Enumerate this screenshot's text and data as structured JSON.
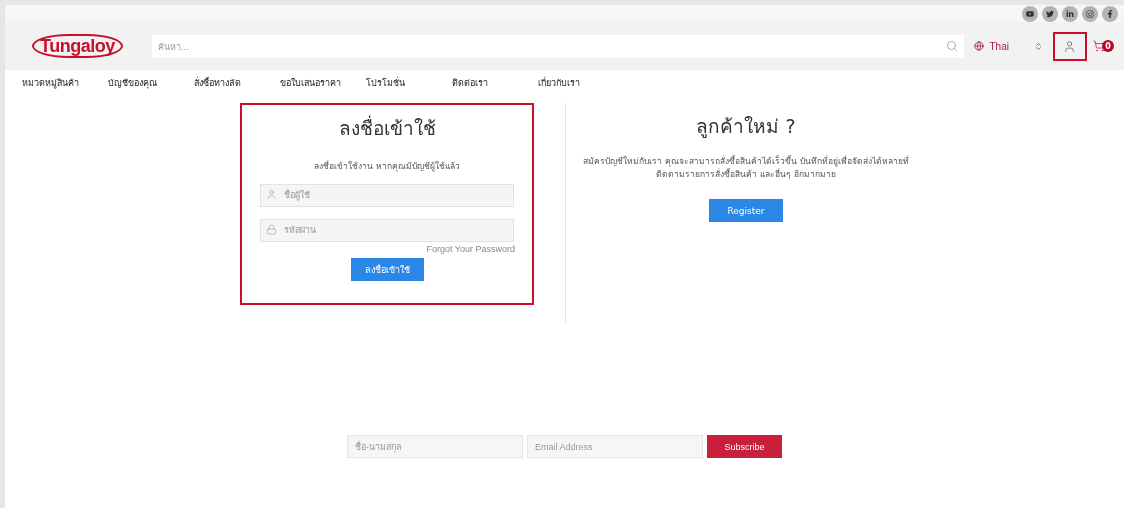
{
  "social_links": [
    {
      "kind": "youtube"
    },
    {
      "kind": "twitter"
    },
    {
      "kind": "linkedin"
    },
    {
      "kind": "instagram"
    },
    {
      "kind": "facebook"
    }
  ],
  "header": {
    "logo": "Tungaloy",
    "search": {
      "placeholder": "ค้นหา..."
    },
    "language": "Thai",
    "account_highlighted": true,
    "cart_count": "0"
  },
  "nav": [
    "หมวดหมู่สินค้า",
    "บัญชีของคุณ",
    "สั่งซื้อทางลัด",
    "ขอใบเสนอราคา",
    "โปรโมชั่น",
    "ติดต่อเรา",
    "เกี่ยวกับเรา"
  ],
  "login": {
    "highlighted": true,
    "title": "ลงชื่อเข้าใช้",
    "subtitle": "ลงชื่อเข้าใช้งาน หากคุณมีบัญชีผู้ใช้แล้ว",
    "username": {
      "placeholder": "ชื่อผู้ใช้"
    },
    "password": {
      "placeholder": "รหัสผ่าน"
    },
    "forgot_link": "Forgot Your Password",
    "button": "ลงชื่อเข้าใช้"
  },
  "new_customer": {
    "title": "ลูกค้าใหม่ ?",
    "description_lines": [
      "สมัครบัญชีใหม่กับเรา คุณจะสามารถสั่งซื้อสินค้าได้เร็วขึ้น บันทึกที่อยู่เพื่อจัดส่งได้หลายที่",
      "ติดตามรายการสั่งซื้อสินค้า และอื่นๆ อีกมากมาย"
    ],
    "button": "Register"
  },
  "newsletter": {
    "name": {
      "placeholder": "ชื่อ-นามสกุล"
    },
    "email": {
      "placeholder": "Email Address"
    },
    "button": "Subscribe"
  }
}
